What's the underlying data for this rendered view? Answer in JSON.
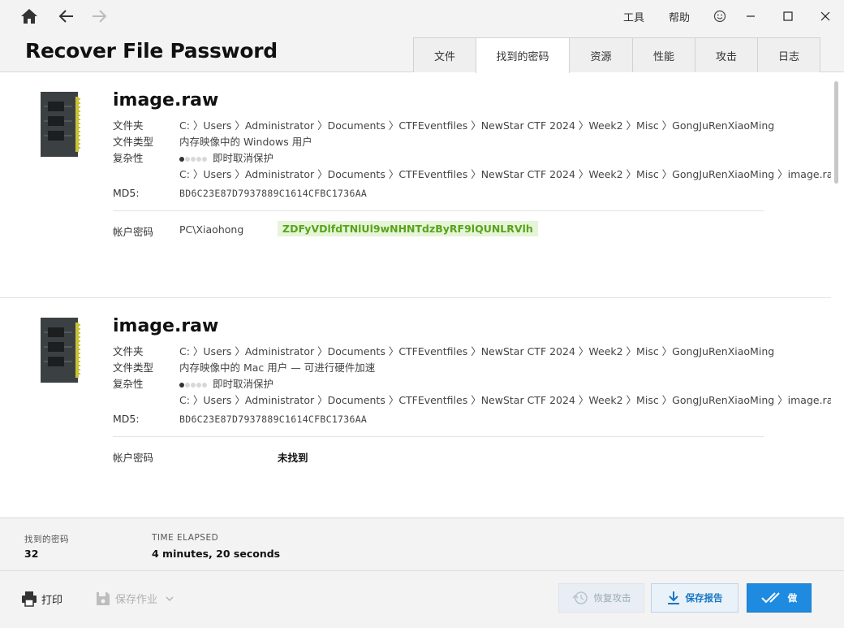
{
  "header": {
    "app_title": "Recover File Password",
    "menu": {
      "tools": "工具",
      "help": "帮助"
    },
    "tabs": [
      {
        "label": "文件",
        "active": false
      },
      {
        "label": "找到的密码",
        "active": true
      },
      {
        "label": "资源",
        "active": false
      },
      {
        "label": "性能",
        "active": false
      },
      {
        "label": "攻击",
        "active": false
      },
      {
        "label": "日志",
        "active": false
      }
    ]
  },
  "results": [
    {
      "file_name": "image.raw",
      "folder_label": "文件夹",
      "folder_path": "C: 〉Users 〉Administrator 〉Documents 〉CTFEventfiles 〉NewStar CTF 2024 〉Week2 〉Misc 〉GongJuRenXiaoMing",
      "type_label": "文件类型",
      "file_type": "内存映像中的 Windows 用户",
      "complexity_label": "复杂性",
      "complexity_level": 1,
      "complexity_max": 5,
      "complexity_text": "即时取消保护",
      "full_path": "C: 〉Users 〉Administrator 〉Documents 〉CTFEventfiles 〉NewStar CTF 2024 〉Week2 〉Misc 〉GongJuRenXiaoMing 〉image.raw",
      "md5_label": "MD5:",
      "md5": "BD6C23E87D7937889C1614CFBC1736AA",
      "account_label": "帐户密码",
      "account": "PC\\Xiaohong",
      "password": "ZDFyVDlfdTNlUl9wNHNTdzByRF9lQUNLRVlh",
      "found": true
    },
    {
      "file_name": "image.raw",
      "folder_label": "文件夹",
      "folder_path": "C: 〉Users 〉Administrator 〉Documents 〉CTFEventfiles 〉NewStar CTF 2024 〉Week2 〉Misc 〉GongJuRenXiaoMing",
      "type_label": "文件类型",
      "file_type": "内存映像中的 Mac 用户 — 可进行硬件加速",
      "complexity_label": "复杂性",
      "complexity_level": 1,
      "complexity_max": 5,
      "complexity_text": "即时取消保护",
      "full_path": "C: 〉Users 〉Administrator 〉Documents 〉CTFEventfiles 〉NewStar CTF 2024 〉Week2 〉Misc 〉GongJuRenXiaoMing 〉image.raw",
      "md5_label": "MD5:",
      "md5": "BD6C23E87D7937889C1614CFBC1736AA",
      "account_label": "帐户密码",
      "status_text": "未找到",
      "found": false
    }
  ],
  "stats": {
    "found_label": "找到的密码",
    "found_value": "32",
    "elapsed_label": "TIME ELAPSED",
    "elapsed_value": "4 minutes, 20 seconds"
  },
  "footer": {
    "print_label": "打印",
    "save_job_label": "保存作业",
    "resume_label": "恢复攻击",
    "save_report_label": "保存报告",
    "done_label": "做"
  },
  "colors": {
    "accent": "#1e8be0",
    "password_text": "#57a41a",
    "password_bg": "#e6f4d8"
  }
}
